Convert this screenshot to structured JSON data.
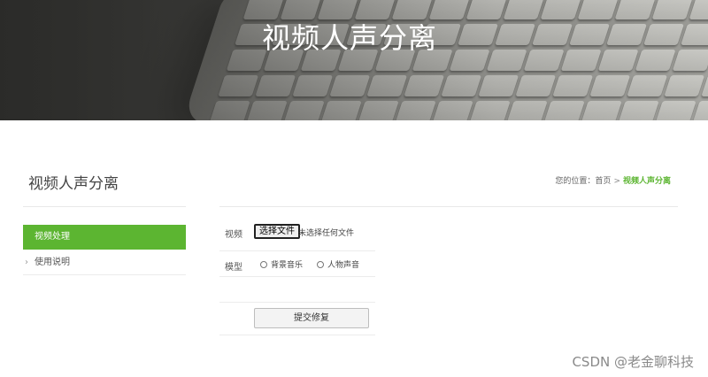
{
  "banner": {
    "title": "视频人声分离"
  },
  "header": {
    "page_title": "视频人声分离",
    "breadcrumb": {
      "prefix": "您的位置：",
      "home": "首页",
      "separator": ">",
      "current": "视频人声分离"
    }
  },
  "sidebar": {
    "items": [
      {
        "label": "视频处理",
        "active": true
      },
      {
        "label": "使用说明",
        "active": false
      }
    ]
  },
  "form": {
    "video_label": "视频",
    "file_button_label": "选择文件",
    "file_status": "未选择任何文件",
    "model_label": "模型",
    "model_options": [
      {
        "label": "背景音乐",
        "selected": false
      },
      {
        "label": "人物声音",
        "selected": false
      }
    ],
    "submit_label": "提交修复"
  },
  "watermark": "CSDN @老金聊科技",
  "colors": {
    "accent": "#5cb531",
    "banner_dark": "#3d3d3b"
  }
}
